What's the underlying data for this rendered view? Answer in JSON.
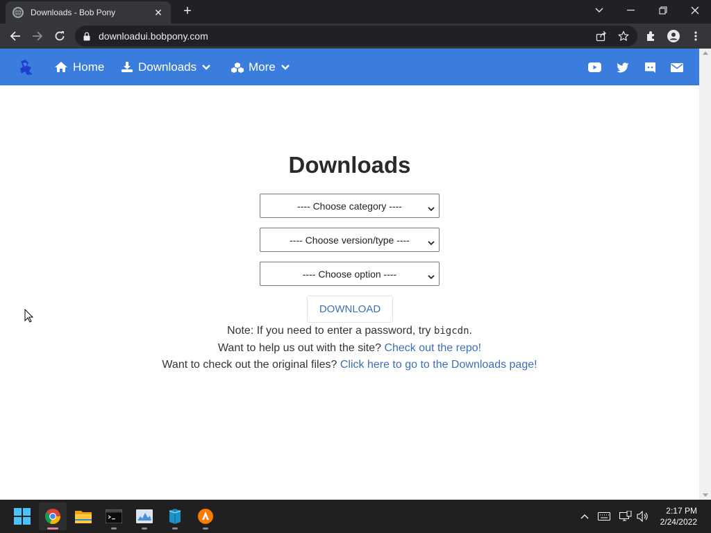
{
  "browser": {
    "tab_title": "Downloads - Bob Pony",
    "url": "downloadui.bobpony.com"
  },
  "navbar": {
    "items": [
      {
        "label": "Home",
        "icon": "home-icon"
      },
      {
        "label": "Downloads",
        "icon": "download-icon",
        "dropdown": true
      },
      {
        "label": "More",
        "icon": "cubes-icon",
        "dropdown": true
      }
    ],
    "social": [
      "youtube-icon",
      "twitter-icon",
      "discord-icon",
      "mail-icon"
    ],
    "background_color": "#3b7ddd"
  },
  "main": {
    "title": "Downloads",
    "selects": [
      {
        "selected": "---- Choose category ----"
      },
      {
        "selected": "---- Choose version/type ----"
      },
      {
        "selected": "---- Choose option ----"
      }
    ],
    "download_button": "DOWNLOAD",
    "note_prefix": "Note: If you need to enter a password, try ",
    "note_password": "bigcdn",
    "note_suffix": ".",
    "help_text": "Want to help us out with the site? ",
    "help_link": "Check out the repo!",
    "files_text": "Want to check out the original files? ",
    "files_link": "Click here to go to the Downloads page!",
    "link_color": "#3b6fb6"
  },
  "taskbar": {
    "apps": [
      "start-icon",
      "chrome-icon",
      "file-explorer-icon",
      "terminal-icon",
      "resource-monitor-icon",
      "package-icon",
      "avast-icon"
    ],
    "time": "2:17 PM",
    "date": "2/24/2022"
  }
}
